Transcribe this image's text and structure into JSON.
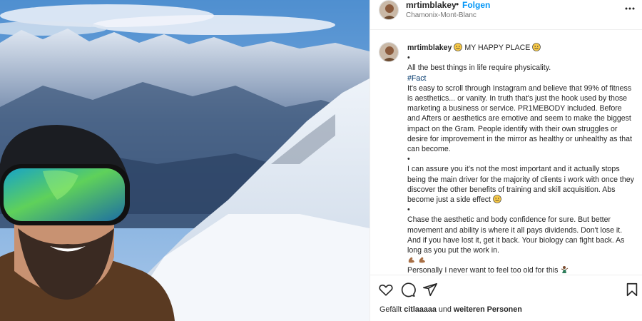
{
  "photo": {
    "alt": ""
  },
  "header": {
    "username": "mrtimblakey",
    "separator": "•",
    "follow_label": "Folgen",
    "location": "Chamonix-Mont-Blanc",
    "more_icon": "more-horizontal-icon"
  },
  "caption": {
    "username": "mrtimblakey",
    "title": "MY HAPPY PLACE",
    "bullet": "•",
    "line1": "All the best things in life require physicality.",
    "hashtag": "#Fact",
    "para1": "It's easy to scroll through Instagram and believe that 99% of fitness is aesthetics... or vanity. In truth that's just the hook used by those marketing a business or service. PR1MEBODY included. Before and Afters or aesthetics are emotive and seem to make the biggest impact on the Gram. People identify with their own struggles or desire for improvement in the mirror as healthy or unhealthy as that can become.",
    "para2": "I can assure you it's not the most important and it actually stops being the main driver for the majority of clients i work with once they discover the other benefits of training and skill acquisition. Abs become just a side effect",
    "para3": "Chase the aesthetic and body confidence for sure. But better movement and ability is where it all pays dividends. Don't lose it. And if you have lost it, get it back. Your biology can fight back. As long as you put the work in.",
    "para4": "Personally I never want to feel too old for this"
  },
  "actions": {
    "like_icon": "heart-icon",
    "comment_icon": "comment-icon",
    "share_icon": "share-icon",
    "save_icon": "bookmark-icon"
  },
  "likes": {
    "prefix": "Gefällt",
    "user": "citlaaaaa",
    "middle": "und",
    "others": "weiteren Personen"
  },
  "colors": {
    "link": "#0095f6",
    "hashtag": "#00376b",
    "text": "#262626",
    "secondary": "#737373"
  }
}
